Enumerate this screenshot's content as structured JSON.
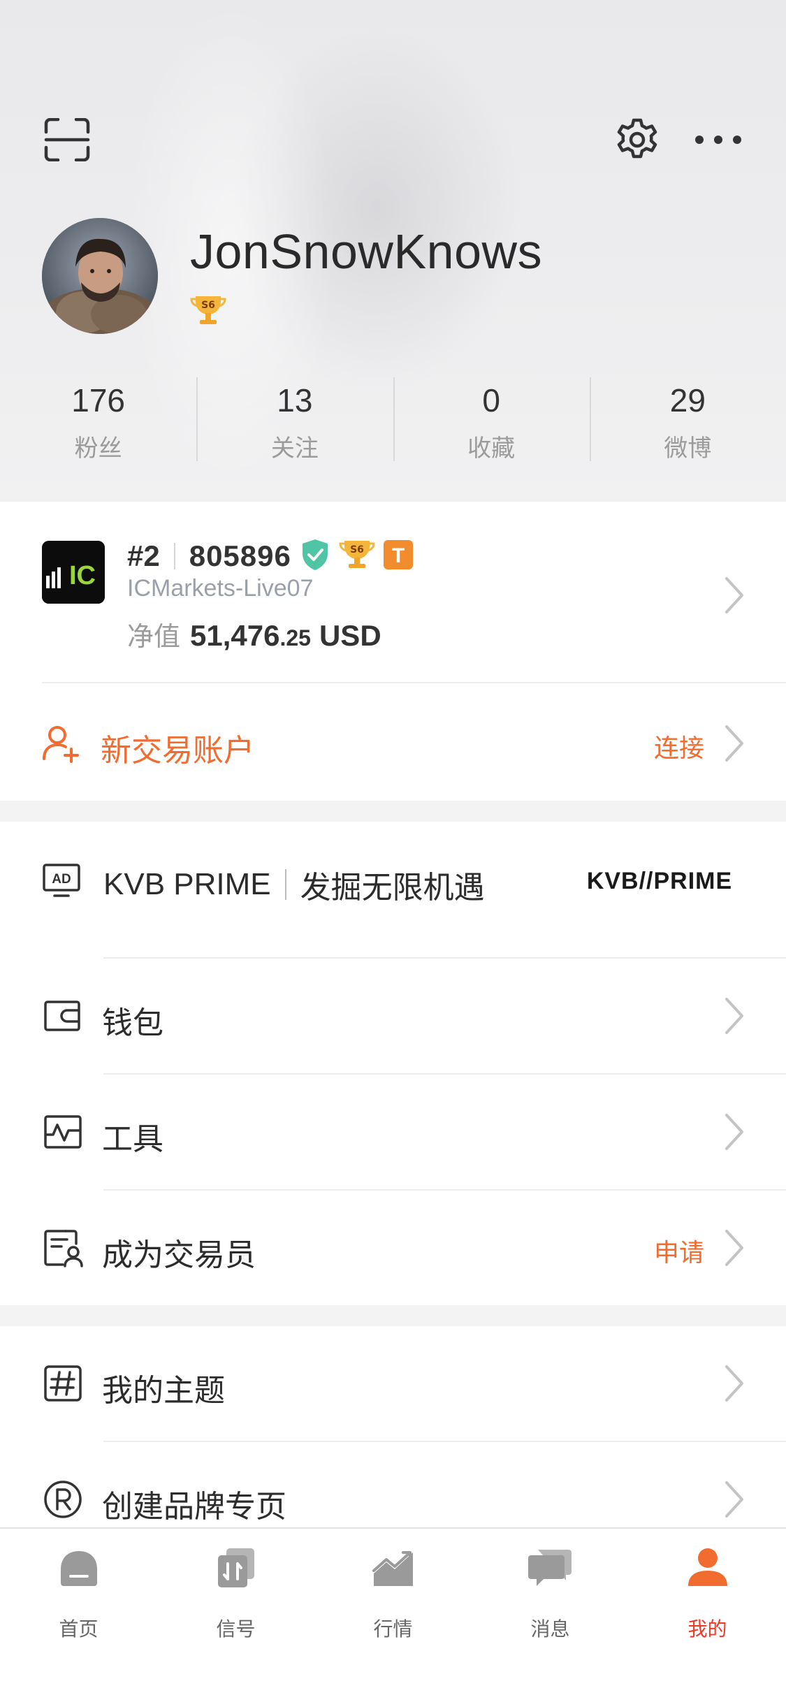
{
  "profile": {
    "username": "JonSnowKnows",
    "level_badge": "S6",
    "stats": [
      {
        "value": "176",
        "label": "粉丝"
      },
      {
        "value": "13",
        "label": "关注"
      },
      {
        "value": "0",
        "label": "收藏"
      },
      {
        "value": "29",
        "label": "微博"
      }
    ]
  },
  "account": {
    "rank": "#2",
    "number": "805896",
    "badge_level": "S6",
    "badge_t": "T",
    "server": "ICMarkets-Live07",
    "equity_label": "净值",
    "equity_int": "51,476",
    "equity_dec": ".25",
    "currency": "USD",
    "broker_logo_text": "IC"
  },
  "new_account": {
    "label": "新交易账户",
    "action": "连接"
  },
  "ad": {
    "badge": "AD",
    "brand": "KVB PRIME",
    "slogan": "发掘无限机遇",
    "logo_text": "KVB//PRIME"
  },
  "menu": [
    {
      "label": "钱包",
      "icon": "wallet-icon",
      "action": ""
    },
    {
      "label": "工具",
      "icon": "tools-chart-icon",
      "action": ""
    },
    {
      "label": "成为交易员",
      "icon": "trader-apply-icon",
      "action": "申请"
    },
    {
      "label": "我的主题",
      "icon": "hashtag-icon",
      "action": ""
    },
    {
      "label": "创建品牌专页",
      "icon": "registered-icon",
      "action": ""
    }
  ],
  "tabs": [
    {
      "label": "首页",
      "icon": "home-icon"
    },
    {
      "label": "信号",
      "icon": "signal-icon"
    },
    {
      "label": "行情",
      "icon": "market-icon"
    },
    {
      "label": "消息",
      "icon": "message-icon"
    },
    {
      "label": "我的",
      "icon": "profile-icon",
      "active": true
    }
  ],
  "colors": {
    "accent": "#f26c2f",
    "active_tab": "#ee3a28",
    "verified": "#4fc5a6",
    "trophy": "#f5b53b"
  }
}
